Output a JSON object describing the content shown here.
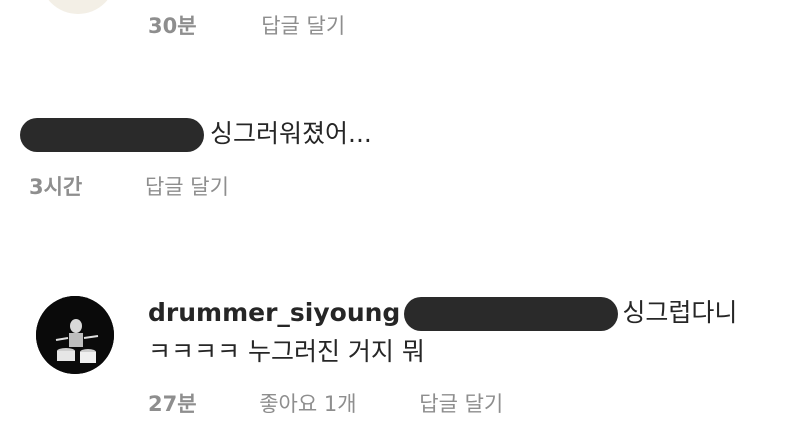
{
  "comments": [
    {
      "time": "30분",
      "reply": "답글 달기"
    },
    {
      "text": "싱그러워졌어...",
      "time": "3시간",
      "reply": "답글 달기"
    },
    {
      "username": "drummer_siyoung",
      "text_after_mention": "싱그럽다니",
      "text_line2": "ㅋㅋㅋㅋ 누그러진 거지 뭐",
      "time": "27분",
      "likes": "좋아요 1개",
      "reply": "답글 달기"
    }
  ],
  "colors": {
    "text": "#262626",
    "meta": "#8e8e8e",
    "redaction": "#2a2a2a",
    "background": "#ffffff"
  }
}
